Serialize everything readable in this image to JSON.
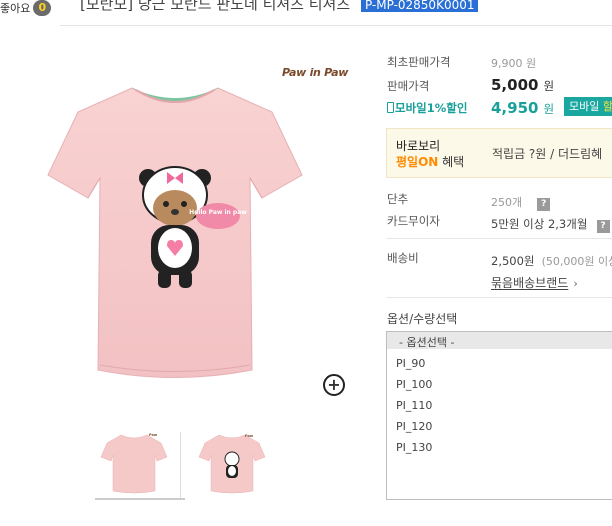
{
  "header": {
    "like_label": "좋아요",
    "like_count": "0",
    "product_title_partial": "[모란모] 당근 모란드 판도데 티셔츠 티셔츠",
    "product_code": "P-MP-02850K0001"
  },
  "product_image": {
    "brand_logo": "Paw in Paw",
    "bubble_text": "Hello Paw in paw",
    "zoom_icon": "plus-circle-icon"
  },
  "pricing": {
    "initial_price_label": "최초판매가격",
    "initial_price_value": "9,900 원",
    "sale_price_label": "판매가격",
    "sale_price_value": "5,000",
    "won": "원",
    "mobile_discount_label": "모바일1%할인",
    "mobile_price_value": "4,950",
    "mobile_button_label": "모바일",
    "mobile_button_suffix": "할"
  },
  "promo": {
    "line1": "바로보리",
    "line2_highlight": "평일ON",
    "line2_rest": " 혜택",
    "right_text": "적립금 ?원 / 더드림혜"
  },
  "details": {
    "unit_label": "단추",
    "unit_value": "250개",
    "card_label": "카드무이자",
    "card_value": "5만원 이상 2,3개월",
    "shipping_label": "배송비",
    "shipping_value": "2,500원",
    "shipping_note": "(50,000원 이상",
    "bundle_link": "묶음배송브랜드",
    "info_icon_glyph": "?"
  },
  "options": {
    "title": "옵션/수량선택",
    "placeholder": "- 옵션선택 -",
    "items": [
      "PI_90",
      "PI_100",
      "PI_110",
      "PI_120",
      "PI_130"
    ]
  },
  "colors": {
    "accent_teal": "#1aa7a0",
    "promo_orange": "#ff8a00",
    "shirt_pink": "#f6c9c9"
  }
}
